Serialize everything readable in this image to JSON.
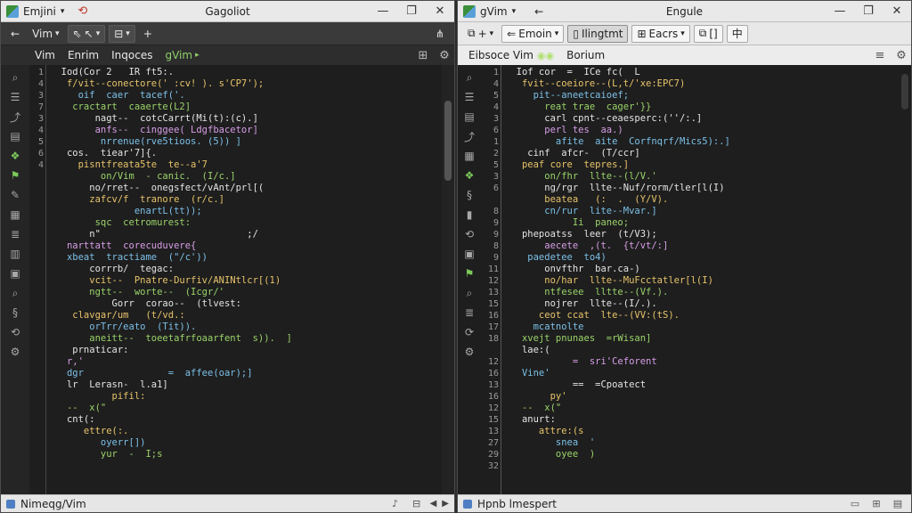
{
  "colors": {
    "editor_bg": "#1e1e1e",
    "accent_green": "#8fd16a",
    "chrome_light": "#e9e9e9"
  },
  "left_window": {
    "app_label": "Emjini",
    "title": "Gagoliot",
    "toolbar": {
      "mode_label": "Vim"
    },
    "tabs": [
      {
        "label": "Vim"
      },
      {
        "label": "Enrim"
      },
      {
        "label": "Inqoces"
      },
      {
        "label": "gVim"
      }
    ],
    "line_numbers": [
      "1",
      "4",
      "3",
      "7",
      "3",
      "4",
      "5",
      "6",
      "4",
      "",
      "",
      "",
      "",
      "",
      "",
      "",
      "",
      "",
      "",
      "",
      "",
      "",
      "",
      "",
      "",
      "",
      "",
      "",
      "",
      "",
      "",
      "",
      "",
      "",
      "",
      "",
      "",
      "",
      "",
      ""
    ],
    "code_lines": [
      "  Iod(Cor 2   IR ft5:.",
      "   f/vit--conectore(' :cv! ). s'CP7');",
      "     oif  caer  tacef('.",
      "    cractart  caaerte(L2]",
      "        nagt--  cotcCarrt(Mi(t):(c).]",
      "        anfs--  cinggee( Ldgfbacetor]",
      "         nrrenue(rve5tioos. (5)) ]",
      "   cos.  tiear'7]{.",
      "     pisntfreata5te  te--a'7",
      "         on/Vim  - canic.  (I/c.]",
      "       no/rret--  onegsfect/vAnt/prl[(",
      "       zafcv/f  tranore  (r/c.]",
      "               enartL(tt));",
      "        sqc  cetromurest:",
      "       n\"                          ;/",
      "   narttatt  corecuduvere{",
      "   xbeat  tractiame  (\"/c'))",
      "       corrrb/  tegac:",
      "       vcit--  Pnatre-Durfiv/ANINtlcr[(1)",
      "       ngtt--  worte--  (Icgr/'",
      "           Gorr  corao--  (tlvest:",
      "    clavgar/um   (t/vd.:",
      "       orTrr/eato  (Tit)).",
      "       aneitt--  toeetafrfoaarfent  s)).  ]",
      "    prnaticar:",
      "   r,'",
      "   dgr               =  affee(oar);]",
      "   lr  Lerasn-  l.a1]",
      "           pifil:",
      "   --  x(\"",
      "   cnt(:",
      "      ettre(:.",
      "         oyerr[])",
      "         yur  -  I;s"
    ],
    "status": {
      "label": "Nimeqg/Vim"
    }
  },
  "right_window": {
    "app_label": "gVim",
    "title": "Engule",
    "toolbar": {
      "btn_plus": "+",
      "btn_emoin": "Emoin",
      "btn_lingtmt": "Ilingtmt",
      "btn_eacrs": "Eacrs",
      "icon_a": "[]",
      "icon_b": "中"
    },
    "tabs": [
      {
        "label": "Eibsoce Vim"
      },
      {
        "label": "Borium"
      }
    ],
    "line_numbers": [
      "1",
      "4",
      "5",
      "4",
      "3",
      "6",
      "1",
      "2",
      "5",
      "3",
      "6",
      "",
      "8",
      "9",
      "9",
      "8",
      "9",
      "11",
      "12",
      "13",
      "15",
      "16",
      "17",
      "18",
      "",
      "12",
      "16",
      "13",
      "16",
      "12",
      "15",
      "13",
      "27",
      "29",
      "32"
    ],
    "code_lines": [
      "  Iof cor  =  ICe fc(  L",
      "   fvit--coeiore--(L,t/'xe:EPC7)",
      "     pit--aneetcaioef;",
      "       reat trae  cager'}}",
      "       carl cpnt--ceaesperc:(''/:.]",
      "       perl tes  aa.)",
      "         afite  aite  Corfnqrf/Mics5):.]",
      "    cinf  afcr-  (T/ccr]",
      "   peaf core  tepres.]",
      "       on/fhr  llte--(l/V.'",
      "       ng/rgr  llte--Nuf/rorm/tler[l(I)",
      "       beatea   (:  .  (Y/V).",
      "       cn/rur  lite--Mvar.]",
      "            Ii  paneo;",
      "   phepoatss  leer  (t/V3);",
      "       aecete  ,(t.  {t/vt/:]",
      "    paedetee  to4)",
      "       onvfthr  bar.ca-)",
      "       no/har  llte--MuFcctatler[l(I)",
      "       ntfesee  lltte--(Vf.).",
      "       nojrer  llte--(I/.).",
      "      ceot ccat  lte--(VV:(tS).",
      "     mcatnolte",
      "   xvejt pnunaes  =rWisan]",
      "   lae:(",
      "            =  sri'Ceforent",
      "   Vine'",
      "            ==  =Cpoatect",
      "        py'",
      "   --  x(\"",
      "   anurt:",
      "      attre:(s",
      "         snea  '",
      "         oyee  )"
    ],
    "status": {
      "label": "Hpnb lmespert"
    }
  }
}
